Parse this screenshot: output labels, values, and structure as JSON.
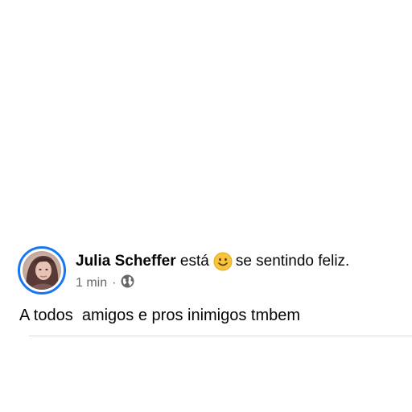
{
  "post": {
    "author": "Julia Scheffer",
    "activity_verb": "está",
    "feeling_emoji": "smiling-face-icon",
    "feeling_text": "se sentindo feliz.",
    "timestamp": "1 min",
    "separator": "·",
    "privacy_icon": "globe-icon",
    "body": "A todos  amigos e pros inimigos tmbem"
  },
  "colors": {
    "avatar_ring": "#1877f2",
    "text_primary": "#050505",
    "text_secondary": "#65676b",
    "emoji_face": "#f7c43c",
    "divider": "#dadde1"
  }
}
